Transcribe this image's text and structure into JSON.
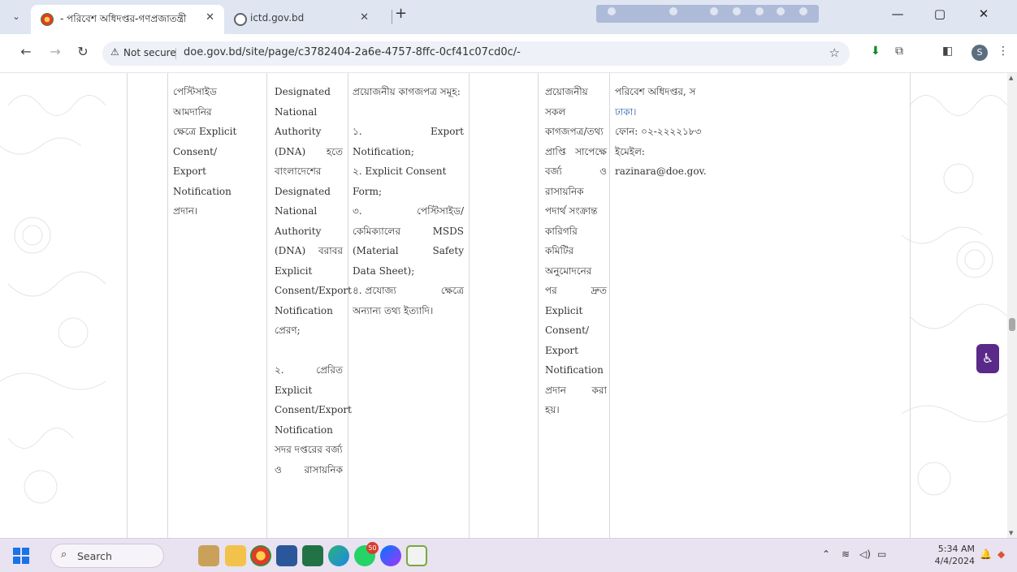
{
  "browser": {
    "tabs": [
      {
        "title": "- পরিবেশ অধিদপ্তর-গণপ্রজাতন্ত্রী",
        "active": true
      },
      {
        "title": "ictd.gov.bd",
        "active": false
      }
    ],
    "new_tab": "+",
    "window_controls": {
      "minimize": "—",
      "maximize": "▢",
      "close": "✕"
    },
    "address": {
      "security_label": "Not secure",
      "url": "doe.gov.bd/site/page/c3782404-2a6e-4757-8ffc-0cf41c07cd0c/-"
    },
    "profile_initial": "S"
  },
  "table": {
    "col2": [
      "পেস্টিসাইড",
      "আমদানির",
      "ক্ষেত্রে Explicit",
      "Consent/",
      "Export",
      "Notification",
      "প্রদান।"
    ],
    "col3": [
      {
        "t": "Designated"
      },
      {
        "t": "National"
      },
      {
        "t": "Authority"
      },
      {
        "a": "(DNA)",
        "b": "হতে"
      },
      {
        "t": "বাংলাদেশের"
      },
      {
        "t": "Designated"
      },
      {
        "t": "National"
      },
      {
        "t": "Authority"
      },
      {
        "a": "(DNA)",
        "b": "বরাবর"
      },
      {
        "t": "Explicit"
      },
      {
        "t": "Consent/Export"
      },
      {
        "t": "Notification"
      },
      {
        "t": "প্রেরণ;"
      },
      {
        "t": ""
      },
      {
        "a": "২.",
        "b": "প্রেরিত"
      },
      {
        "t": "Explicit"
      },
      {
        "t": "Consent/Export"
      },
      {
        "t": "Notification"
      },
      {
        "t": "সদর দপ্তরের বর্জ্য"
      },
      {
        "a": "ও",
        "b": "রাসায়নিক"
      }
    ],
    "col4": [
      {
        "t": "প্রয়োজনীয় কাগজপত্র সমূহ:"
      },
      {
        "t": ""
      },
      {
        "a": "১.",
        "b": "Export"
      },
      {
        "t": "Notification;"
      },
      {
        "t": "২. Explicit Consent"
      },
      {
        "t": "Form;"
      },
      {
        "a": "৩.",
        "b": "পেস্টিসাইড/"
      },
      {
        "a": "কেমিক্যালের",
        "b": "MSDS"
      },
      {
        "a": "(Material",
        "b": "Safety"
      },
      {
        "t": "Data Sheet);"
      },
      {
        "a": "৪.  প্রযোজ্য",
        "b": "ক্ষেত্রে"
      },
      {
        "t": "অন্যান্য তথ্য ইত্যাদি।"
      }
    ],
    "col6": [
      {
        "t": "প্রয়োজনীয়"
      },
      {
        "t": "সকল"
      },
      {
        "t": "কাগজপত্র/তথ্য"
      },
      {
        "a": "প্রাপ্তি",
        "b": "সাপেক্ষে"
      },
      {
        "a": "বর্জ্য",
        "b": "ও"
      },
      {
        "t": "রাসায়নিক"
      },
      {
        "t": "পদার্থ সংক্রান্ত"
      },
      {
        "t": "কারিগরি"
      },
      {
        "t": "কমিটির"
      },
      {
        "t": "অনুমোদনের"
      },
      {
        "a": "পর",
        "b": "দ্রুত"
      },
      {
        "t": "Explicit"
      },
      {
        "t": "Consent/"
      },
      {
        "t": "Export"
      },
      {
        "t": "Notification"
      },
      {
        "a": "প্রদান",
        "b": "করা"
      },
      {
        "t": "হয়।"
      }
    ],
    "col7": [
      "পরিবেশ অধিদপ্তর, স",
      "ঢাকা।",
      "ফোন: ০২-২২২২১৮৩",
      "ইমেইল:",
      "razinara@doe.gov."
    ]
  },
  "taskbar": {
    "search_label": "Search",
    "chat_badge": "50",
    "clock": {
      "time": "5:34 AM",
      "date": "4/4/2024"
    }
  }
}
